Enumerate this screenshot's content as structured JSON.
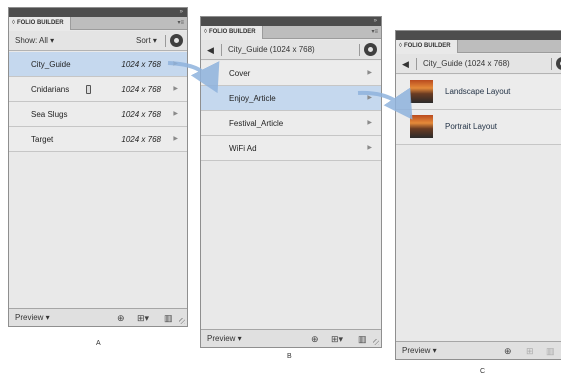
{
  "panel_a": {
    "tab_title": "FOLIO BUILDER",
    "show_label": "Show: All ▾",
    "sort_label": "Sort ▾",
    "folios": [
      {
        "name": "City_Guide",
        "dims": "1024 x 768"
      },
      {
        "name": "Cnidarians",
        "dims": "1024 x 768"
      },
      {
        "name": "Sea Slugs",
        "dims": "1024 x 768"
      },
      {
        "name": "Target",
        "dims": "1024 x 768"
      }
    ],
    "preview_label": "Preview ▾",
    "caption": "A"
  },
  "panel_b": {
    "tab_title": "FOLIO BUILDER",
    "folio_header": "City_Guide (1024 x 768)",
    "articles": [
      {
        "name": "Cover"
      },
      {
        "name": "Enjoy_Article"
      },
      {
        "name": "Festival_Article"
      },
      {
        "name": "WiFi Ad"
      }
    ],
    "preview_label": "Preview ▾",
    "caption": "B"
  },
  "panel_c": {
    "tab_title": "FOLIO BUILDER",
    "folio_header": "City_Guide (1024 x 768)",
    "layouts": [
      {
        "name": "Landscape Layout"
      },
      {
        "name": "Portrait Layout"
      }
    ],
    "preview_label": "Preview ▾",
    "caption": "C"
  },
  "colors": {
    "selected_row": "#c5d8ee",
    "arrow": "#8fb3dd",
    "titlebar": "#4d4d4d"
  },
  "icons": [
    "back-arrow-icon",
    "gear-icon",
    "chevron-right-icon",
    "mobile-device-icon",
    "new-folder-icon",
    "add-icon",
    "trash-icon",
    "resize-grip-icon"
  ]
}
